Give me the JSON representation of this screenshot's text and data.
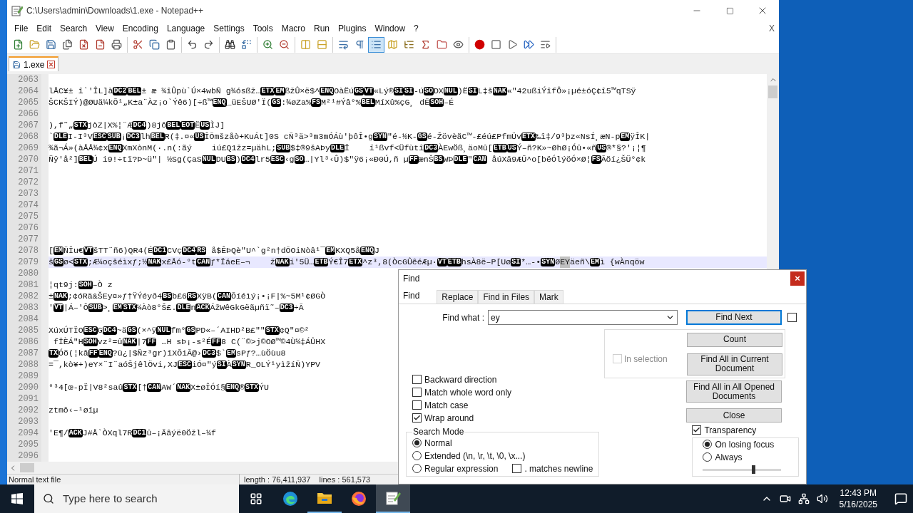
{
  "window": {
    "title": "C:\\Users\\admin\\Downloads\\1.exe - Notepad++"
  },
  "menu": [
    "File",
    "Edit",
    "Search",
    "View",
    "Encoding",
    "Language",
    "Settings",
    "Tools",
    "Macro",
    "Run",
    "Plugins",
    "Window",
    "?"
  ],
  "menu_close": "X",
  "toolbar": [
    [
      {
        "pressed": false
      },
      {
        "pressed": false
      },
      {
        "pressed": false
      },
      {
        "pressed": false
      },
      {
        "pressed": false
      },
      {
        "pressed": false
      },
      {
        "pressed": false
      }
    ],
    [
      {
        "pressed": false
      },
      {
        "pressed": false
      },
      {
        "pressed": false
      }
    ],
    [
      {
        "pressed": false
      },
      {
        "pressed": false
      }
    ],
    [
      {
        "pressed": false
      },
      {
        "pressed": false
      }
    ],
    [
      {
        "pressed": false
      },
      {
        "pressed": false
      }
    ],
    [
      {
        "pressed": false
      },
      {
        "pressed": false
      }
    ],
    [
      {
        "pressed": false
      },
      {
        "pressed": false
      },
      {
        "pressed": true
      },
      {
        "pressed": false
      },
      {
        "pressed": false
      },
      {
        "pressed": false
      },
      {
        "pressed": false
      },
      {
        "pressed": false
      }
    ],
    [
      {
        "pressed": false
      },
      {
        "pressed": false
      },
      {
        "pressed": false
      },
      {
        "pressed": false
      },
      {
        "pressed": false
      }
    ]
  ],
  "tabs": [
    {
      "label": "1.exe",
      "selected": true
    }
  ],
  "lines": [
    {
      "number": "2063",
      "current": false
    },
    {
      "number": "2064",
      "current": false,
      "segments": [
        {
          "kind": "text",
          "text": "lÅC¥± î`'ÎL]à"
        },
        {
          "kind": "ctrl",
          "text": "DC2"
        },
        {
          "kind": "ctrl",
          "text": "BEL"
        },
        {
          "kind": "text",
          "text": "± æ ¾îÛpù`Ú×4wbÑ g¾ósßž…"
        },
        {
          "kind": "ctrl",
          "text": "ETX"
        },
        {
          "kind": "ctrl",
          "text": "EM"
        },
        {
          "kind": "text",
          "text": "ßžÛ×ë$^"
        },
        {
          "kind": "ctrl",
          "text": "ENQ"
        },
        {
          "kind": "text",
          "text": "OàËú"
        },
        {
          "kind": "ctrl",
          "text": "GS"
        },
        {
          "kind": "ctrl",
          "text": "VT"
        },
        {
          "kind": "text",
          "text": "«Lý®"
        },
        {
          "kind": "ctrl",
          "text": "SI"
        },
        {
          "kind": "ctrl",
          "text": "SI"
        },
        {
          "kind": "text",
          "text": "-ú"
        },
        {
          "kind": "ctrl",
          "text": "SO"
        },
        {
          "kind": "text",
          "text": "DX"
        },
        {
          "kind": "ctrl",
          "text": "NUL"
        },
        {
          "kind": "text",
          "text": ")Ë"
        },
        {
          "kind": "ctrl",
          "text": "SI"
        },
        {
          "kind": "text",
          "text": "L‡š"
        },
        {
          "kind": "ctrl",
          "text": "NAK"
        },
        {
          "kind": "text",
          "text": "«\"42ußiÝîfÔ»¡µé±óÇ¢î5™qTSÿ"
        }
      ]
    },
    {
      "number": "2065",
      "current": false,
      "segments": [
        {
          "kind": "text",
          "text": "ŠCKŠIÝ)@ØUä¼kÕ¹„K±a¨Àz¡o`Ýê6)[÷ß™"
        },
        {
          "kind": "ctrl",
          "text": "ENQ"
        },
        {
          "kind": "text",
          "text": "_üEŠUØ'Ï("
        },
        {
          "kind": "ctrl",
          "text": "GS"
        },
        {
          "kind": "text",
          "text": ":¾øZa%"
        },
        {
          "kind": "ctrl",
          "text": "FS"
        },
        {
          "kind": "text",
          "text": "M²¹#Ýâ°%"
        },
        {
          "kind": "ctrl",
          "text": "BEL"
        },
        {
          "kind": "text",
          "text": "MíXû%çG¸ dË"
        },
        {
          "kind": "ctrl",
          "text": "SOH"
        },
        {
          "kind": "text",
          "text": "–É"
        }
      ]
    },
    {
      "number": "2066",
      "current": false
    },
    {
      "number": "2067",
      "current": false,
      "segments": [
        {
          "kind": "text",
          "text": "),f˜„"
        },
        {
          "kind": "ctrl",
          "text": "STX"
        },
        {
          "kind": "text",
          "text": "jòZ|X%¦¨Æ"
        },
        {
          "kind": "ctrl",
          "text": "DC4"
        },
        {
          "kind": "text",
          "text": ")8jô"
        },
        {
          "kind": "ctrl",
          "text": "BEL"
        },
        {
          "kind": "ctrl",
          "text": "EOT"
        },
        {
          "kind": "text",
          "text": "Ë"
        },
        {
          "kind": "ctrl",
          "text": "US"
        },
        {
          "kind": "text",
          "text": "ÌJ]"
        }
      ]
    },
    {
      "number": "2068",
      "current": false,
      "segments": [
        {
          "kind": "text",
          "text": "`"
        },
        {
          "kind": "ctrl",
          "text": "DLE"
        },
        {
          "kind": "text",
          "text": "I-I³V"
        },
        {
          "kind": "ctrl",
          "text": "ESC"
        },
        {
          "kind": "ctrl",
          "text": "SUB"
        },
        {
          "kind": "text",
          "text": "¡"
        },
        {
          "kind": "ctrl",
          "text": "DC3"
        },
        {
          "kind": "text",
          "text": "lh"
        },
        {
          "kind": "ctrl",
          "text": "BEL"
        },
        {
          "kind": "text",
          "text": "R(‡.¤«"
        },
        {
          "kind": "ctrl",
          "text": "US"
        },
        {
          "kind": "text",
          "text": "ÎÕmšzåò+KuÁt]0S cÑ³ä>³m3mÓÁù'þôÎ•g"
        },
        {
          "kind": "ctrl",
          "text": "SYN"
        },
        {
          "kind": "text",
          "text": "\"é-½K-"
        },
        {
          "kind": "ctrl",
          "text": "GS"
        },
        {
          "kind": "text",
          "text": "é-ŽövèãC™-£éú£PfmÜv"
        },
        {
          "kind": "ctrl",
          "text": "ETX"
        },
        {
          "kind": "text",
          "text": "‰î‡/9³þz«NsÍ¸æN-p"
        },
        {
          "kind": "ctrl",
          "text": "EM"
        },
        {
          "kind": "text",
          "text": "ÿÎK|"
        }
      ]
    },
    {
      "number": "2069",
      "current": false,
      "segments": [
        {
          "kind": "text",
          "text": "¾ã¬Á»(àÅÅ¾¢x"
        },
        {
          "kind": "ctrl",
          "text": "ENQ"
        },
        {
          "kind": "text",
          "text": "XmXònM(·.n(:ãý    iú£Q1žz=µähL;"
        },
        {
          "kind": "ctrl",
          "text": "SUB"
        },
        {
          "kind": "text",
          "text": "$‡®9šAÞy"
        },
        {
          "kind": "ctrl",
          "text": "DLE"
        },
        {
          "kind": "text",
          "text": "Ï    ï¹ßvf<Üfùtî"
        },
        {
          "kind": "ctrl",
          "text": "DC3"
        },
        {
          "kind": "text",
          "text": "ÀEwÖß¸äoMû["
        },
        {
          "kind": "ctrl",
          "text": "ETB"
        },
        {
          "kind": "ctrl",
          "text": "US"
        },
        {
          "kind": "text",
          "text": "Ý–ñ?K»~ØhØ¡Óû•«ñ"
        },
        {
          "kind": "ctrl",
          "text": "US"
        },
        {
          "kind": "text",
          "text": "®*§?'¡¦¶"
        }
      ]
    },
    {
      "number": "2070",
      "current": false,
      "segments": [
        {
          "kind": "text",
          "text": "Ñÿ'å²]"
        },
        {
          "kind": "ctrl",
          "text": "BEL"
        },
        {
          "kind": "text",
          "text": "Ú i9!÷tï?Þ~ü\"| ½Sg(ÇaS"
        },
        {
          "kind": "ctrl",
          "text": "NUL"
        },
        {
          "kind": "text",
          "text": "DU"
        },
        {
          "kind": "ctrl",
          "text": "BS"
        },
        {
          "kind": "text",
          "text": ")"
        },
        {
          "kind": "ctrl",
          "text": "DC4"
        },
        {
          "kind": "text",
          "text": "lr5"
        },
        {
          "kind": "ctrl",
          "text": "ESC"
        },
        {
          "kind": "text",
          "text": "‹g"
        },
        {
          "kind": "ctrl",
          "text": "SO"
        },
        {
          "kind": "text",
          "text": "…|Yl³‹Û)$\"ÿ6¡«Ð0Ú,ñ µ"
        },
        {
          "kind": "ctrl",
          "text": "FF"
        },
        {
          "kind": "text",
          "text": "ænŠ"
        },
        {
          "kind": "ctrl",
          "text": "BS"
        },
        {
          "kind": "text",
          "text": "WÞ"
        },
        {
          "kind": "ctrl",
          "text": "DLE"
        },
        {
          "kind": "text",
          "text": "\""
        },
        {
          "kind": "ctrl",
          "text": "CAN"
        },
        {
          "kind": "text",
          "text": " åúXä9ÆÜ^o[bëÓlýöÓ×Ø¦"
        },
        {
          "kind": "ctrl",
          "text": "FS"
        },
        {
          "kind": "text",
          "text": "Ãõí¿ŠÜ°¢k"
        }
      ]
    },
    {
      "number": "2071",
      "current": false
    },
    {
      "number": "2072",
      "current": false
    },
    {
      "number": "2073",
      "current": false
    },
    {
      "number": "2074",
      "current": false
    },
    {
      "number": "2075",
      "current": false
    },
    {
      "number": "2076",
      "current": false
    },
    {
      "number": "2077",
      "current": false
    },
    {
      "number": "2078",
      "current": false,
      "segments": [
        {
          "kind": "text",
          "text": "["
        },
        {
          "kind": "ctrl",
          "text": "EM"
        },
        {
          "kind": "text",
          "text": "ÑÎu€"
        },
        {
          "kind": "ctrl",
          "text": "VT"
        },
        {
          "kind": "text",
          "text": "šTT¨ñ6)QR4(É"
        },
        {
          "kind": "ctrl",
          "text": "DC1"
        },
        {
          "kind": "text",
          "text": "CVç"
        },
        {
          "kind": "ctrl",
          "text": "DC4"
        },
        {
          "kind": "ctrl",
          "text": "RS"
        },
        {
          "kind": "text",
          "text": " å$ÊÞQè\"U^`g²n†dÕOiNòâ¹¯"
        },
        {
          "kind": "ctrl",
          "text": "EM"
        },
        {
          "kind": "text",
          "text": "KXQ5å"
        },
        {
          "kind": "ctrl",
          "text": "ENQ"
        },
        {
          "kind": "text",
          "text": "J"
        }
      ]
    },
    {
      "number": "2079",
      "current": true,
      "segments": [
        {
          "kind": "text",
          "text": "š"
        },
        {
          "kind": "ctrl",
          "text": "GS"
        },
        {
          "kind": "text",
          "text": "ø<"
        },
        {
          "kind": "ctrl",
          "text": "STX"
        },
        {
          "kind": "text",
          "text": ";Æ¼oçšéìxƒ;½"
        },
        {
          "kind": "ctrl",
          "text": "NAK"
        },
        {
          "kind": "text",
          "text": "x£Åó-°t"
        },
        {
          "kind": "ctrl",
          "text": "CAN"
        },
        {
          "kind": "text",
          "text": "ƒ*ÏáeE–¬    ž"
        },
        {
          "kind": "ctrl",
          "text": "NAK"
        },
        {
          "kind": "text",
          "text": "í'5Ü…"
        },
        {
          "kind": "ctrl",
          "text": "ETB"
        },
        {
          "kind": "text",
          "text": "Ý€Î7"
        },
        {
          "kind": "ctrl",
          "text": "ETX"
        },
        {
          "kind": "text",
          "text": "^z³,8(ÒcGÛêéÆµ·"
        },
        {
          "kind": "ctrl",
          "text": "VT"
        },
        {
          "kind": "ctrl",
          "text": "ETB"
        },
        {
          "kind": "text",
          "text": "hsÀ8ë–P[Uø"
        },
        {
          "kind": "ctrl",
          "text": "SI"
        },
        {
          "kind": "text",
          "text": "*…-•"
        },
        {
          "kind": "ctrl",
          "text": "SYN"
        },
        {
          "kind": "text",
          "text": "Ø"
        },
        {
          "kind": "match",
          "text": "EY"
        },
        {
          "kind": "text",
          "text": "äeñ\\"
        },
        {
          "kind": "ctrl",
          "text": "EM"
        },
        {
          "kind": "text",
          "text": "ì {wÀnqöw"
        }
      ]
    },
    {
      "number": "2080",
      "current": false
    },
    {
      "number": "2081",
      "current": false,
      "segments": [
        {
          "kind": "text",
          "text": "¦qt9j:"
        },
        {
          "kind": "ctrl",
          "text": "SOH"
        },
        {
          "kind": "text",
          "text": "–Ò z"
        }
      ]
    },
    {
      "number": "2082",
      "current": false,
      "segments": [
        {
          "kind": "text",
          "text": "±"
        },
        {
          "kind": "ctrl",
          "text": "NAK"
        },
        {
          "kind": "text",
          "text": ";¢óRä&ŠEy¤»ƒ†ŸÝéyð4"
        },
        {
          "kind": "ctrl",
          "text": "BS"
        },
        {
          "kind": "text",
          "text": "b£6"
        },
        {
          "kind": "ctrl",
          "text": "RS"
        },
        {
          "kind": "text",
          "text": "XÿB("
        },
        {
          "kind": "ctrl",
          "text": "CAN"
        },
        {
          "kind": "text",
          "text": "Õíéìý¡•¡F|%~5M¹¢ØGÒ"
        }
      ]
    },
    {
      "number": "2083",
      "current": false,
      "segments": [
        {
          "kind": "text",
          "text": "'"
        },
        {
          "kind": "ctrl",
          "text": "VT"
        },
        {
          "kind": "text",
          "text": "|Á–'Ô"
        },
        {
          "kind": "ctrl",
          "text": "SUB"
        },
        {
          "kind": "text",
          "text": ">¸"
        },
        {
          "kind": "ctrl",
          "text": "EM"
        },
        {
          "kind": "ctrl",
          "text": "STX"
        },
        {
          "kind": "text",
          "text": "¼Àò8°Š£."
        },
        {
          "kind": "ctrl",
          "text": "DLE"
        },
        {
          "kind": "text",
          "text": "n"
        },
        {
          "kind": "ctrl",
          "text": "ACK"
        },
        {
          "kind": "text",
          "text": "ÁžWêGkGëãµñï˜–"
        },
        {
          "kind": "ctrl",
          "text": "DC3"
        },
        {
          "kind": "text",
          "text": "÷Ã"
        }
      ]
    },
    {
      "number": "2084",
      "current": false
    },
    {
      "number": "2085",
      "current": false,
      "segments": [
        {
          "kind": "text",
          "text": "XúxÚTÏO"
        },
        {
          "kind": "ctrl",
          "text": "ESC"
        },
        {
          "kind": "text",
          "text": "G"
        },
        {
          "kind": "ctrl",
          "text": "DC4"
        },
        {
          "kind": "text",
          "text": "~ä"
        },
        {
          "kind": "ctrl",
          "text": "GS"
        },
        {
          "kind": "text",
          "text": "(×^ÿ"
        },
        {
          "kind": "ctrl",
          "text": "NUL"
        },
        {
          "kind": "text",
          "text": "fm°"
        },
        {
          "kind": "ctrl",
          "text": "GS"
        },
        {
          "kind": "text",
          "text": "PD«–´AIHD²B£″\""
        },
        {
          "kind": "ctrl",
          "text": "STX"
        },
        {
          "kind": "text",
          "text": "¢Q″¤©²"
        }
      ]
    },
    {
      "number": "2086",
      "current": false,
      "segments": [
        {
          "kind": "text",
          "text": " fÏÈÁ\"H"
        },
        {
          "kind": "ctrl",
          "text": "SOH"
        },
        {
          "kind": "text",
          "text": "vz²=û"
        },
        {
          "kind": "ctrl",
          "text": "NAK"
        },
        {
          "kind": "text",
          "text": "|7"
        },
        {
          "kind": "ctrl",
          "text": "FF"
        },
        {
          "kind": "text",
          "text": " …H sÞ¡-s²É"
        },
        {
          "kind": "ctrl",
          "text": "FF"
        },
        {
          "kind": "text",
          "text": "8 C(¨©>j©OØ™©4Ù¼‡ÁÛHX"
        }
      ]
    },
    {
      "number": "2087",
      "current": false,
      "segments": [
        {
          "kind": "ctrl",
          "text": "TX"
        },
        {
          "kind": "text",
          "text": "Óõ(¦kâ"
        },
        {
          "kind": "ctrl",
          "text": "FF"
        },
        {
          "kind": "ctrl",
          "text": "ENQ"
        },
        {
          "kind": "text",
          "text": "?ü¿|$Ñz³gr)îXÕiÃ@›"
        },
        {
          "kind": "ctrl",
          "text": "DC3"
        },
        {
          "kind": "text",
          "text": "$`"
        },
        {
          "kind": "ctrl",
          "text": "EM"
        },
        {
          "kind": "text",
          "text": "sPƒ?…ùÖùu8"
        }
      ]
    },
    {
      "number": "2088",
      "current": false,
      "segments": [
        {
          "kind": "text",
          "text": "=¯,kò¥+)eY×¨I¨aóŠjêlÖvi,XJ"
        },
        {
          "kind": "ctrl",
          "text": "ESC"
        },
        {
          "kind": "text",
          "text": "iÓ¤″ý"
        },
        {
          "kind": "ctrl",
          "text": "SI"
        },
        {
          "kind": "text",
          "text": "À"
        },
        {
          "kind": "ctrl",
          "text": "SYN"
        },
        {
          "kind": "text",
          "text": "R_OLÝ¹yìžíÑ)YPV"
        }
      ]
    },
    {
      "number": "2089",
      "current": false
    },
    {
      "number": "2090",
      "current": false,
      "segments": [
        {
          "kind": "text",
          "text": "°³4[œ-pÏ|V8²saû"
        },
        {
          "kind": "ctrl",
          "text": "STX"
        },
        {
          "kind": "text",
          "text": "[†"
        },
        {
          "kind": "ctrl",
          "text": "CAN"
        },
        {
          "kind": "text",
          "text": "AW´"
        },
        {
          "kind": "ctrl",
          "text": "NAK"
        },
        {
          "kind": "text",
          "text": "X±øÎÓí§"
        },
        {
          "kind": "ctrl",
          "text": "ENQ"
        },
        {
          "kind": "text",
          "text": "®"
        },
        {
          "kind": "ctrl",
          "text": "STX"
        },
        {
          "kind": "text",
          "text": "ÝU"
        }
      ]
    },
    {
      "number": "2091",
      "current": false
    },
    {
      "number": "2092",
      "current": false,
      "segments": [
        {
          "kind": "text",
          "text": "ztmô‹–¹øîµ"
        }
      ]
    },
    {
      "number": "2093",
      "current": false
    },
    {
      "number": "2094",
      "current": false,
      "segments": [
        {
          "kind": "text",
          "text": "'E¶/"
        },
        {
          "kind": "ctrl",
          "text": "ACK"
        },
        {
          "kind": "text",
          "text": "J#Å`ÒXql7R"
        },
        {
          "kind": "ctrl",
          "text": "DC1"
        },
        {
          "kind": "text",
          "text": "û–¡Ãâýë0Öžl–¼f"
        }
      ]
    },
    {
      "number": "2095",
      "current": false
    },
    {
      "number": "2096",
      "current": false
    }
  ],
  "status_bar": [
    "Normal text file",
    "length : 76,411,937    lines : 561,573"
  ],
  "find_dialog": {
    "title": "Find",
    "close": "×",
    "tabs": [
      {
        "label": "Find",
        "selected": true
      },
      {
        "label": "Replace",
        "selected": false
      },
      {
        "label": "Find in Files",
        "selected": false
      },
      {
        "label": "Mark",
        "selected": false
      }
    ],
    "find_what_label": "Find what :",
    "find_what_value": "ey",
    "side_checkbox": {
      "checked": false
    },
    "buttons": [
      {
        "label": "Find Next",
        "default": true
      },
      {
        "label": "Count",
        "default": false
      },
      {
        "label": "Find All in Current Document",
        "default": false
      },
      {
        "label": "Find All in All Opened Documents",
        "default": false
      },
      {
        "label": "Close",
        "default": false
      }
    ],
    "in_selection": {
      "label": "In selection",
      "checked": false,
      "disabled": true
    },
    "options": [
      {
        "label": "Backward direction",
        "checked": false
      },
      {
        "label": "Match whole word only",
        "checked": false
      },
      {
        "label": "Match case",
        "checked": false
      },
      {
        "label": "Wrap around",
        "checked": true
      }
    ],
    "search_mode": {
      "title": "Search Mode",
      "options": [
        {
          "label": "Normal",
          "selected": true
        },
        {
          "label": "Extended (\\n, \\r, \\t, \\0, \\x...)",
          "selected": false
        },
        {
          "label": "Regular expression",
          "selected": false
        }
      ],
      "matches_newline": {
        "label": ". matches newline",
        "checked": false
      }
    },
    "transparency": {
      "label": "Transparency",
      "checked": true,
      "options": [
        {
          "label": "On losing focus",
          "selected": true
        },
        {
          "label": "Always",
          "selected": false
        }
      ],
      "level": 0.65
    }
  },
  "taskbar": {
    "search_placeholder": "Type here to search",
    "apps": [
      {
        "running": false,
        "active": false
      },
      {
        "running": true,
        "active": false
      },
      {
        "running": false,
        "active": false
      },
      {
        "running": true,
        "active": true
      }
    ],
    "time": "12:43 PM",
    "date": "5/16/2025"
  }
}
